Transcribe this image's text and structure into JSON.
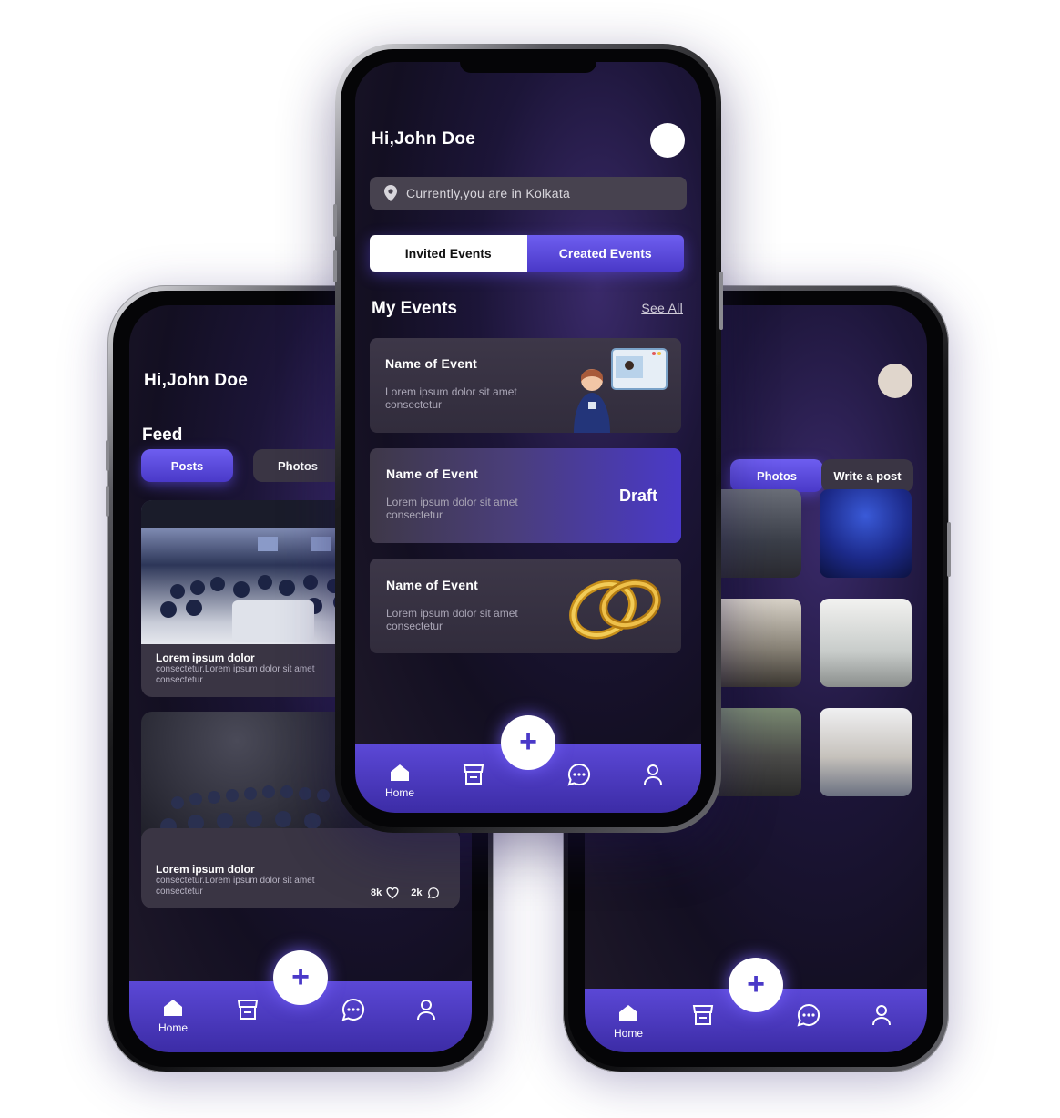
{
  "left_phone": {
    "greeting": "Hi,John Doe",
    "section_title": "Feed",
    "tabs": [
      "Posts",
      "Photos"
    ],
    "posts": [
      {
        "title": "Lorem ipsum dolor",
        "body": "consectetur.Lorem ipsum dolor sit amet consectetur"
      },
      {
        "title": "Lorem ipsum dolor",
        "body": "consectetur.Lorem ipsum dolor sit amet consectetur",
        "likes": "8k",
        "comments": "2k"
      }
    ],
    "nav": {
      "home": "Home"
    }
  },
  "center_phone": {
    "greeting": "Hi,John Doe",
    "location": "Currently,you are in Kolkata",
    "tabs": [
      "Invited Events",
      "Created Events"
    ],
    "section_title": "My Events",
    "see_all": "See All",
    "events": [
      {
        "title": "Name of Event",
        "body": "Lorem ipsum dolor sit amet consectetur",
        "badge": ""
      },
      {
        "title": "Name of Event",
        "body": "Lorem ipsum dolor sit amet consectetur",
        "badge": "Draft"
      },
      {
        "title": "Name of Event",
        "body": "Lorem ipsum dolor sit amet consectetur",
        "badge": ""
      }
    ],
    "nav": {
      "home": "Home"
    }
  },
  "right_phone": {
    "tabs": [
      "Photos",
      "Write a post"
    ],
    "nav": {
      "home": "Home"
    }
  },
  "colors": {
    "accent": "#5b48d6",
    "accent_dark": "#3c2ca6",
    "card": "#3a3544",
    "background": "#130f22"
  },
  "icons": [
    "home-icon",
    "store-icon",
    "chat-icon",
    "profile-icon",
    "plus-icon",
    "location-pin-icon",
    "heart-icon",
    "comment-icon"
  ]
}
